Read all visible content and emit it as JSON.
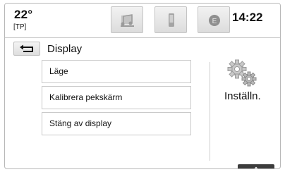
{
  "status_bar": {
    "temperature": "22°",
    "traffic_program": "[TP]",
    "clock": "14:22",
    "tabs": [
      {
        "icon": "audio-icon"
      },
      {
        "icon": "phone-icon"
      },
      {
        "icon": "e-icon",
        "label": "E"
      }
    ]
  },
  "header": {
    "back_icon": "back-arrow-icon",
    "title": "Display"
  },
  "menu": {
    "items": [
      {
        "label": "Läge"
      },
      {
        "label": "Kalibrera pekskärm"
      },
      {
        "label": "Stäng av display"
      }
    ]
  },
  "side_panel": {
    "icon": "settings-gears-icon",
    "label": "Inställn."
  },
  "footer": {
    "scroll_icon": "chevron-up-icon"
  }
}
